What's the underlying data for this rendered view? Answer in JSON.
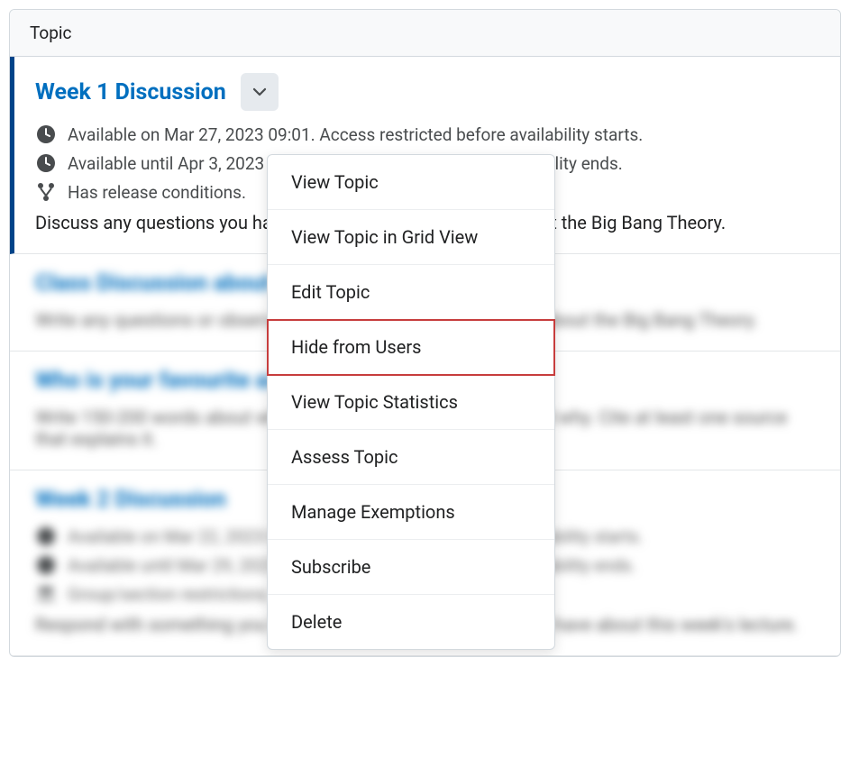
{
  "header": {
    "label": "Topic"
  },
  "topics": [
    {
      "title": "Week 1 Discussion",
      "availStart": "Available on Mar 27, 2023 09:01. Access restricted before availability starts.",
      "availEnd": "Available until Apr 3, 2023 09:01. Access restricted after availability ends.",
      "releaseCond": "Has release conditions.",
      "desc": "Discuss any questions you have about this week's readings about the Big Bang Theory."
    },
    {
      "title": "Class Discussion about the Big Bang",
      "desc": "Write any questions or observations about this week's readings about the Big Bang Theory."
    },
    {
      "title": "Who is your favourite astronomer?",
      "desc": "Write 150-200 words about who your favourite astronomer is and why. Cite at least one source that explains it."
    },
    {
      "title": "Week 2 Discussion",
      "availStart": "Available on Mar 22, 2023 09:01. Access restricted before availability starts.",
      "availEnd": "Available until Mar 29, 2023 09:01. Access restricted after availability ends.",
      "groupRestrict": "Group/section restrictions.",
      "desc": "Respond with something you found interesting or a question you have about this week's lecture."
    }
  ],
  "menu": {
    "items": [
      "View Topic",
      "View Topic in Grid View",
      "Edit Topic",
      "Hide from Users",
      "View Topic Statistics",
      "Assess Topic",
      "Manage Exemptions",
      "Subscribe",
      "Delete"
    ]
  }
}
